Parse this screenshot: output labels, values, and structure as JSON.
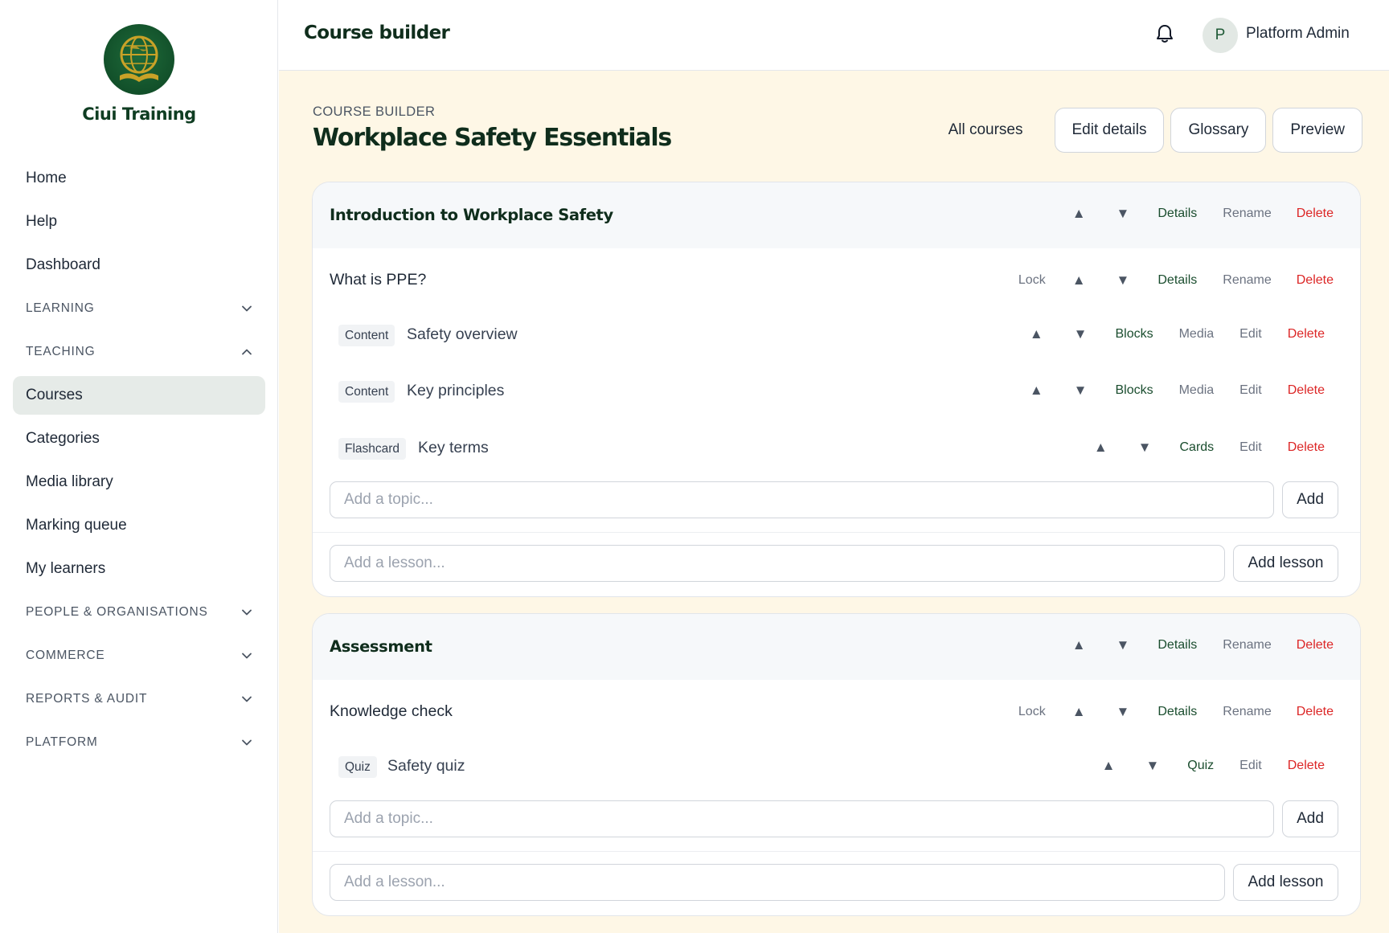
{
  "brand": {
    "name": "Ciui Training",
    "logo_icon": "globe-book-logo"
  },
  "sidebar": {
    "items_top": [
      {
        "label": "Home"
      },
      {
        "label": "Help"
      },
      {
        "label": "Dashboard"
      }
    ],
    "sections": {
      "learning": "LEARNING",
      "teaching": "TEACHING",
      "people": "PEOPLE & ORGANISATIONS",
      "commerce": "COMMERCE",
      "reports": "REPORTS & AUDIT",
      "platform": "PLATFORM"
    },
    "teaching_items": [
      {
        "label": "Courses",
        "active": true
      },
      {
        "label": "Categories"
      },
      {
        "label": "Media library"
      },
      {
        "label": "Marking queue"
      },
      {
        "label": "My learners"
      }
    ]
  },
  "topbar": {
    "title": "Course builder",
    "notification_icon": "bell-icon",
    "user": {
      "initial": "P",
      "name": "Platform Admin"
    }
  },
  "page": {
    "eyebrow": "COURSE BUILDER",
    "title": "Workplace Safety Essentials",
    "actions": {
      "all_courses": "All courses",
      "edit_details": "Edit details",
      "glossary": "Glossary",
      "preview": "Preview"
    }
  },
  "labels": {
    "up": "▲",
    "down": "▼",
    "lock": "Lock",
    "details": "Details",
    "rename": "Rename",
    "delete": "Delete",
    "blocks": "Blocks",
    "media": "Media",
    "edit": "Edit",
    "cards": "Cards",
    "quiz": "Quiz",
    "add": "Add",
    "add_lesson": "Add lesson",
    "topic_placeholder": "Add a topic...",
    "lesson_placeholder": "Add a lesson..."
  },
  "modules": [
    {
      "title": "Introduction to Workplace Safety",
      "lessons": [
        {
          "title": "What is PPE?",
          "topics": [
            {
              "type": "Content",
              "title": "Safety overview"
            },
            {
              "type": "Content",
              "title": "Key principles"
            },
            {
              "type": "Flashcard",
              "title": "Key terms"
            }
          ]
        }
      ]
    },
    {
      "title": "Assessment",
      "lessons": [
        {
          "title": "Knowledge check",
          "topics": [
            {
              "type": "Quiz",
              "title": "Safety quiz"
            }
          ]
        }
      ]
    }
  ],
  "colors": {
    "accent": "#1a4d2e",
    "danger": "#dc2626",
    "main_bg": "#fef7e6",
    "active_nav": "#e6ebe8"
  }
}
